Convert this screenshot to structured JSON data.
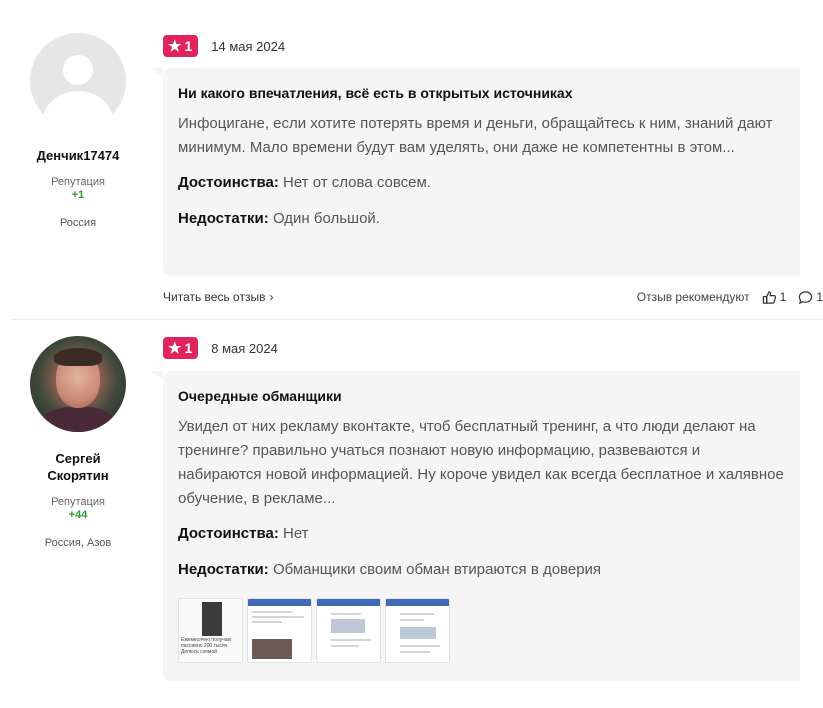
{
  "reviews": [
    {
      "author": {
        "name": "Денчик17474",
        "reputation_label": "Репутация",
        "reputation_value": "+1",
        "location": "Россия",
        "avatar": "placeholder"
      },
      "rating": "1",
      "date": "14 мая 2024",
      "title": "Ни какого впечатления, всё есть в открытых источниках",
      "text": "Инфоцигане, если хотите потерять время и деньги, обращайтесь к ним, знаний дают минимум. Мало времени будут вам уделять, они даже не компетентны в этом...",
      "pros_label": "Достоинства:",
      "pros": "Нет от слова совсем.",
      "cons_label": "Недостатки:",
      "cons": "Один большой.",
      "read_more": "Читать весь отзыв",
      "recommend_label": "Отзыв рекомендуют",
      "likes": "1",
      "comments": "1"
    },
    {
      "author": {
        "name": "Сергей Скорятин",
        "reputation_label": "Репутация",
        "reputation_value": "+44",
        "location": "Россия, Азов",
        "avatar": "photo"
      },
      "rating": "1",
      "date": "8 мая 2024",
      "title": "Очередные обманщики",
      "text": "Увидел от них рекламу вконтакте, чтоб бесплатный тренинг, а что люди делают на тренинге? правильно учаться познают новую информацию, развеваются и набираются новой информацией. Ну короче увидел как всегда бесплатное и халявное обучение, в рекламе...",
      "pros_label": "Достоинства:",
      "pros": "Нет",
      "cons_label": "Недостатки:",
      "cons": "Обманщики своим обман втираются в доверия",
      "thumbnails": [
        {
          "tiny_top": "Ежемесячно получаю",
          "tiny_mid": "пассивно 200 тысяч.",
          "tiny_bot": "Делюсь схемой"
        },
        {},
        {},
        {}
      ]
    }
  ],
  "icons": {
    "star": "star-icon",
    "chevron": "chevron-right-icon",
    "like": "thumbs-up-icon",
    "comment": "comment-icon"
  },
  "colors": {
    "badge": "#e0245e",
    "reputation": "#2a9d2a",
    "card_bg": "#f5f5f5"
  }
}
